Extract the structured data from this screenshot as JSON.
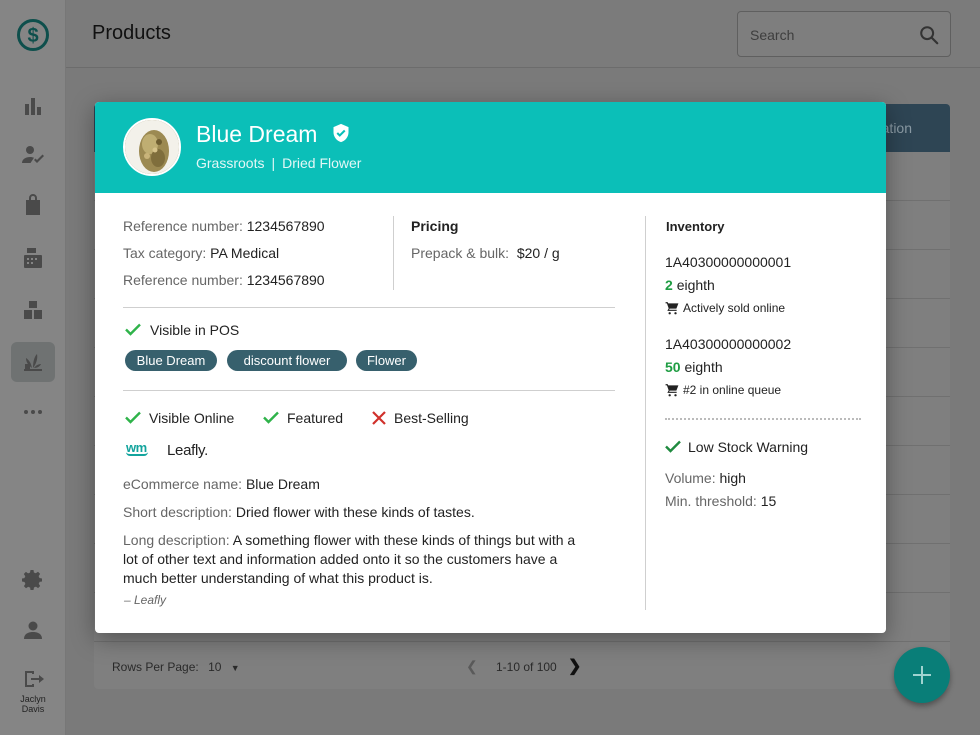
{
  "app": {
    "page_title": "Products",
    "search_placeholder": "Search",
    "user_name_first": "Jaclyn",
    "user_name_last": "Davis",
    "table_header_partial": "ation",
    "footer": {
      "rows_per_page_label": "Rows Per Page:",
      "rows_per_page_value": "10",
      "page_range": "1-10 of 100"
    },
    "sidebar_icons": [
      "logo-dollar-icon",
      "dashboard-bar-chart-icon",
      "user-check-icon",
      "shopping-bag-icon",
      "register-icon",
      "inventory-boxes-icon",
      "products-plant-icon",
      "more-horizontal-icon",
      "settings-gear-icon",
      "account-person-icon",
      "logout-icon"
    ]
  },
  "modal": {
    "product_name": "Blue Dream",
    "brand": "Grassroots",
    "category": "Dried Flower",
    "details": [
      {
        "label": "Reference number:",
        "value": "1234567890"
      },
      {
        "label": "Tax category:",
        "value": "PA Medical"
      },
      {
        "label": "Reference number:",
        "value": "1234567890"
      }
    ],
    "pricing": {
      "title": "Pricing",
      "label": "Prepack & bulk:",
      "value": "$20 / g"
    },
    "pos": {
      "visible_label": "Visible in POS",
      "tags": [
        "Blue Dream",
        "discount flower",
        "Flower"
      ]
    },
    "online": {
      "visible_online": "Visible Online",
      "featured": "Featured",
      "best_selling": "Best-Selling",
      "partners": [
        "wm",
        "Leafly."
      ],
      "ecommerce_name_label": "eCommerce name:",
      "ecommerce_name": "Blue Dream",
      "short_desc_label": "Short description:",
      "short_desc": "Dried flower with these kinds of tastes.",
      "long_desc_label": "Long description:",
      "long_desc_line1": "A something flower with these kinds of things but with a",
      "long_desc_line2": "lot of other text and information added onto it so the customers have a",
      "long_desc_line3": "much better understanding of what this product is.",
      "attribution": "– Leafly"
    },
    "inventory": {
      "title": "Inventory",
      "items": [
        {
          "id": "1A40300000000001",
          "qty": "2",
          "unit": "eighth",
          "status": "Actively sold online"
        },
        {
          "id": "1A40300000000002",
          "qty": "50",
          "unit": "eighth",
          "status": "#2 in online queue"
        }
      ],
      "low_stock_label": "Low Stock Warning",
      "volume_label": "Volume:",
      "volume_value": "high",
      "threshold_label": "Min. threshold:",
      "threshold_value": "15"
    }
  },
  "colors": {
    "header_teal": "#0bbfb8",
    "chip": "#37606d",
    "check_green": "#2fb34a",
    "cross_red": "#d0302b",
    "fab": "#097e78"
  }
}
